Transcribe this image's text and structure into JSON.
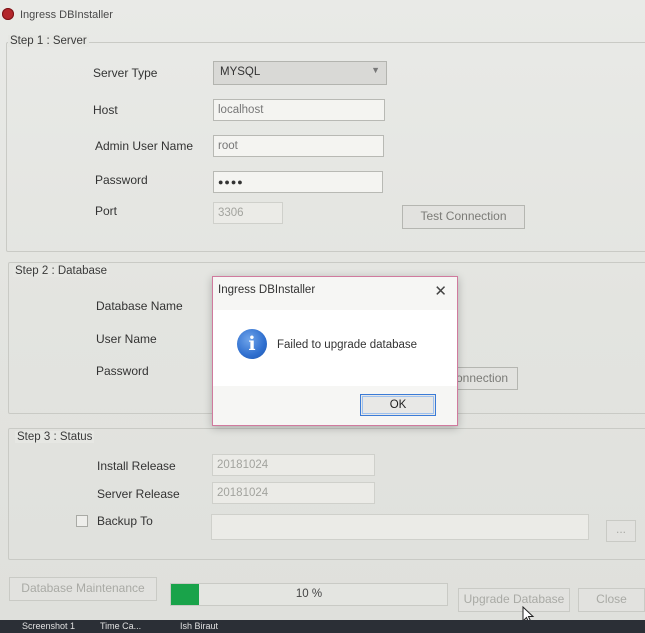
{
  "window": {
    "title": "Ingress DBInstaller"
  },
  "step1": {
    "legend": "Step 1 : Server",
    "server_type_label": "Server Type",
    "server_type_value": "MYSQL",
    "host_label": "Host",
    "host_value": "localhost",
    "admin_user_label": "Admin User Name",
    "admin_user_value": "root",
    "password_label": "Password",
    "password_value": "●●●●",
    "port_label": "Port",
    "port_value": "3306",
    "test_connection_label": "Test Connection"
  },
  "step2": {
    "legend": "Step 2 : Database",
    "db_name_label": "Database Name",
    "user_name_label": "User Name",
    "password_label": "Password",
    "test_connection_partial": "onnection"
  },
  "step3": {
    "legend": "Step 3 : Status",
    "install_release_label": "Install Release",
    "install_release_value": "20181024",
    "server_release_label": "Server Release",
    "server_release_value": "20181024",
    "backup_label": "Backup To",
    "browse_label": "..."
  },
  "footer": {
    "db_maintenance_label": "Database Maintenance",
    "progress_text": "10 %",
    "progress_fraction": 0.1,
    "upgrade_label": "Upgrade Database",
    "close_label": "Close"
  },
  "dialog": {
    "title": "Ingress DBInstaller",
    "close_glyph": "✕",
    "message": "Failed to upgrade database",
    "ok_label": "OK",
    "icon_glyph": "i"
  },
  "taskbar": {
    "items": [
      "Screenshot 1",
      "Time Ca...",
      "Ish Biraut"
    ]
  },
  "colors": {
    "progress": "#19a34a",
    "dialog_border": "#d07a9e",
    "ok_focus": "#3b7bd6"
  }
}
